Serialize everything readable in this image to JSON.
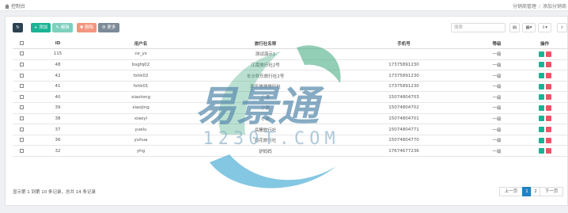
{
  "topbar": {
    "home_label": "控制台",
    "breadcrumb": [
      "分销商管理",
      "添加分销商"
    ]
  },
  "toolbar": {
    "add_label": "+ 添加",
    "edit_label": "✎ 编辑",
    "delete_label": "✖ 删除",
    "more_label": "⚙ 更多",
    "refresh_icon": "↻",
    "search_placeholder": "搜索",
    "view_list_icon": "▤",
    "columns_icon": "▦▾",
    "export_icon": "⇩▾",
    "search_icon": "⌕"
  },
  "table": {
    "headers": [
      "ID",
      "用户名",
      "旅行社名称",
      "手机号",
      "等级",
      "操作"
    ],
    "rows": [
      {
        "id": "115",
        "username": "ce_ys",
        "agency": "测试演示1",
        "phone": "",
        "level": "一级"
      },
      {
        "id": "48",
        "username": "bsgfq02",
        "agency": "江南旅行社2号",
        "phone": "17375891230",
        "level": "一级"
      },
      {
        "id": "42",
        "username": "fxhk02",
        "agency": "长沙欢乐旅行社2号",
        "phone": "17375891230",
        "level": "一级"
      },
      {
        "id": "41",
        "username": "fxhk01",
        "agency": "欢乐旅游旅行社",
        "phone": "17375891230",
        "level": "一级"
      },
      {
        "id": "40",
        "username": "xiaotong",
        "agency": "小通",
        "phone": "15074804703",
        "level": "一级"
      },
      {
        "id": "39",
        "username": "xiaojing",
        "agency": "小景",
        "phone": "15074804702",
        "level": "一级"
      },
      {
        "id": "38",
        "username": "xiaoyi",
        "agency": "小易",
        "phone": "15074804701",
        "level": "一级"
      },
      {
        "id": "37",
        "username": "yuelu",
        "agency": "岳麓旅行社",
        "phone": "15074804771",
        "level": "一级"
      },
      {
        "id": "36",
        "username": "yuhua",
        "agency": "雨花旅行社",
        "phone": "15074804770",
        "level": "一级"
      },
      {
        "id": "32",
        "username": "yhg",
        "agency": "驴妈妈",
        "phone": "17674677236",
        "level": "一级"
      }
    ]
  },
  "footer": {
    "page_info": "显示第 1 到第 10 条记录，总共 14 条记录",
    "prev_label": "上一页",
    "pages": [
      "1",
      "2"
    ],
    "next_label": "下一页"
  },
  "watermark": {
    "brand": "易景通",
    "domain": "1230T.COM"
  },
  "colors": {
    "add": "#1ab394",
    "edit": "#7ed0bd",
    "delete": "#f3957f",
    "more": "#7b8a96",
    "refresh": "#2c4152",
    "page_active": "#1c84c6"
  }
}
